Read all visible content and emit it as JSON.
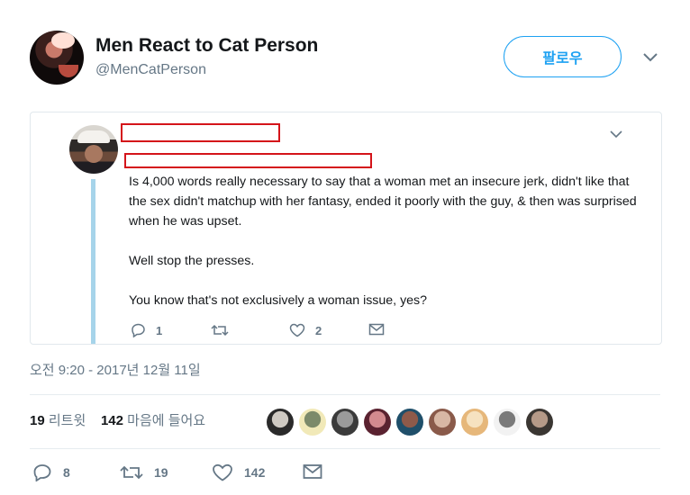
{
  "account": {
    "name": "Men React to Cat Person",
    "handle": "@MenCatPerson",
    "follow_label": "팔로우"
  },
  "quoted_tweet": {
    "paragraphs": [
      "Is 4,000 words really necessary to say that a woman met an insecure jerk, didn't like that the sex didn't matchup with her fantasy, ended it poorly with the guy, & then was surprised when he was upset.",
      "Well stop the presses.",
      "You know that's not exclusively a woman issue, yes?"
    ],
    "replies": "1",
    "retweets": "",
    "likes": "2"
  },
  "tweet": {
    "timestamp": "오전 9:20 - 2017년 12월 11일",
    "retweet_count": "19",
    "retweet_label": "리트윗",
    "like_count": "142",
    "like_label": "마음에 들어요",
    "actions": {
      "replies": "8",
      "retweets": "19",
      "likes": "142"
    }
  },
  "likers": [
    {
      "colors": [
        "#2a2a2a",
        "#cfcac3"
      ]
    },
    {
      "colors": [
        "#f1e9b8",
        "#7c8a6a"
      ]
    },
    {
      "colors": [
        "#3b3b3b",
        "#9a9a9a"
      ]
    },
    {
      "colors": [
        "#5a2230",
        "#d38a8f"
      ]
    },
    {
      "colors": [
        "#1f4f6a",
        "#8e5a4a"
      ]
    },
    {
      "colors": [
        "#8a5a4a",
        "#d8b7a4"
      ]
    },
    {
      "colors": [
        "#e6b77a",
        "#f6e2c0"
      ]
    },
    {
      "colors": [
        "#f2f2f2",
        "#7a7a7a"
      ]
    },
    {
      "colors": [
        "#3a3632",
        "#b59a88"
      ]
    }
  ],
  "colors": {
    "accent": "#1da1f2",
    "muted": "#657786",
    "redaction": "#d4141a"
  }
}
